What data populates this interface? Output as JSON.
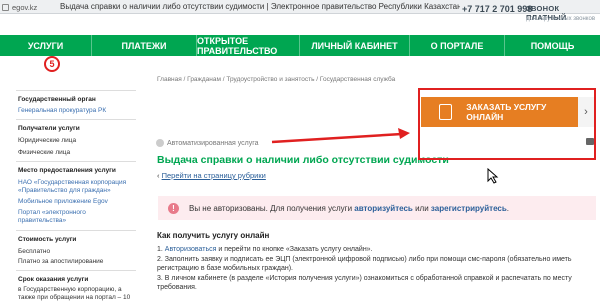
{
  "browser": {
    "url_domain": "egov.kz",
    "tab_title": "Выдача справки о наличии либо отсутствии судимости | Электронное правительство Республики Казахстан",
    "phone": "+7 717 2 701 998",
    "phone_label": "ЗВОНОК ПЛАТНЫЙ",
    "phone_sub": "для зарубежных звонков"
  },
  "nav": {
    "items": [
      "УСЛУГИ",
      "ПЛАТЕЖИ",
      "ОТКРЫТОЕ ПРАВИТЕЛЬСТВО",
      "ЛИЧНЫЙ КАБИНЕТ",
      "О ПОРТАЛЕ",
      "ПОМОЩЬ"
    ]
  },
  "annotation_badge": "5",
  "sidebar": {
    "gov_org_head": "Государственный орган",
    "gov_org_link": "Генеральная прокуратура РК",
    "recipients_head": "Получатели услуги",
    "recipient_1": "Юридические лица",
    "recipient_2": "Физические лица",
    "place_head": "Место предоставления услуги",
    "place_1": "НАО «Государственная корпорация «Правительство для граждан»",
    "place_2": "Мобильное приложение Egov",
    "place_3": "Портал «электронного правительства»",
    "cost_head": "Стоимость услуги",
    "cost_1": "Бесплатно",
    "cost_2": "Платно за апостилирование",
    "term_head": "Срок оказания услуги",
    "term_1": "в Государственную корпорацию, а также при обращении на портал – 10"
  },
  "main": {
    "breadcrumb": "Главная  /  Гражданам  /  Трудоустройство и занятость  /  Государственная служба",
    "auto_label": "Автоматизированная услуга",
    "title": "Выдача справки о наличии либо отсутствии судимости",
    "back_arrow": "‹",
    "back_link": "Перейти на страницу рубрики",
    "order_button": "ЗАКАЗАТЬ УСЛУГУ ОНЛАЙН",
    "order_chevron": "›",
    "alert_icon": "!",
    "alert_text_1": "Вы не авторизованы. Для получения услуги",
    "alert_link_1": "авторизуйтесь",
    "alert_text_2": "или",
    "alert_link_2": "зарегистрируйтесь",
    "alert_text_3": ".",
    "howto_title": "Как получить услугу онлайн",
    "step1_link": "Авторизоваться",
    "step1_text": "и перейти по кнопке «Заказать услугу онлайн».",
    "step2_text": "2. Заполнить заявку и подписать ее ЭЦП (электронной цифровой подписью) либо при помощи смс-пароля (обязательно иметь регистрацию в базе мобильных граждан).",
    "step3_text": "3. В личном кабинете (в разделе «История получения услуги») ознакомиться с обработанной справкой и распечатать по месту требования."
  },
  "colors": {
    "nav_green": "#00a651",
    "order_orange": "#e67e22",
    "annotation_red": "#e02020",
    "alert_bg": "#fdecef"
  }
}
